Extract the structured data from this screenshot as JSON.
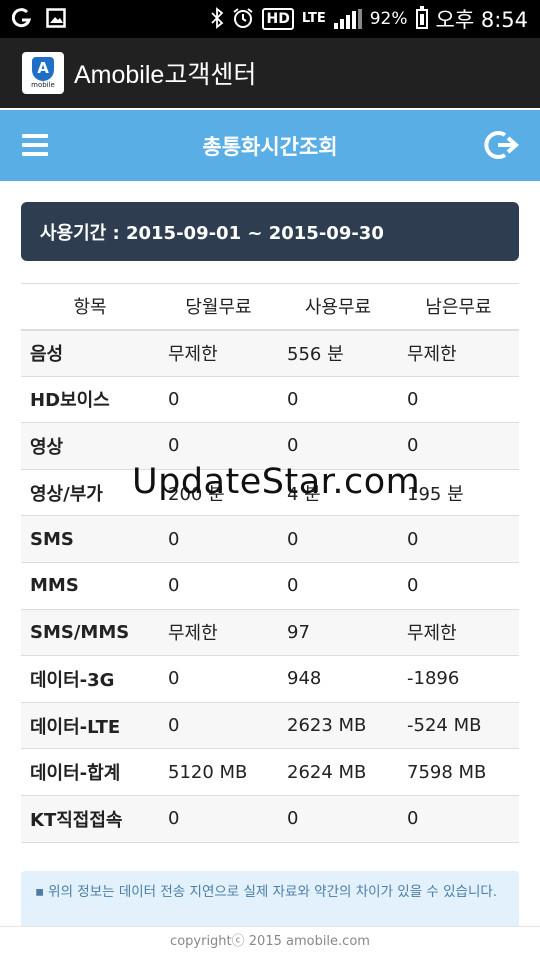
{
  "status_bar": {
    "battery_percent": "92%",
    "time": "오후 8:54",
    "hd_label": "HD",
    "lte_label": "LTE",
    "icons": [
      "g-icon",
      "image-icon",
      "bluetooth-icon",
      "alarm-icon",
      "hd-voice-icon",
      "lte-icon",
      "signal-icon",
      "battery-icon"
    ]
  },
  "app_bar": {
    "logo_letter": "A",
    "logo_text": "mobile",
    "title": "Amobile고객센터"
  },
  "header": {
    "title": "총통화시간조회",
    "accent_color": "#5aaee6"
  },
  "period": {
    "label": "사용기간 : 2015-09-01 ~ 2015-09-30",
    "bg_color": "#2e3e50"
  },
  "usage_table": {
    "headers": [
      "항목",
      "당월무료",
      "사용무료",
      "남은무료"
    ],
    "rows": [
      [
        "음성",
        "무제한",
        "556 분",
        "무제한"
      ],
      [
        "HD보이스",
        "0",
        "0",
        "0"
      ],
      [
        "영상",
        "0",
        "0",
        "0"
      ],
      [
        "영상/부가",
        "200 분",
        "4 분",
        "195 분"
      ],
      [
        "SMS",
        "0",
        "0",
        "0"
      ],
      [
        "MMS",
        "0",
        "0",
        "0"
      ],
      [
        "SMS/MMS",
        "무제한",
        "97",
        "무제한"
      ],
      [
        "데이터-3G",
        "0",
        "948",
        "-1896"
      ],
      [
        "데이터-LTE",
        "0",
        "2623 MB",
        "-524 MB"
      ],
      [
        "데이터-합계",
        "5120 MB",
        "2624 MB",
        "7598 MB"
      ],
      [
        "KT직접접속",
        "0",
        "0",
        "0"
      ]
    ]
  },
  "watermark": "UpdateStar.com",
  "notice": {
    "bullet": "▪",
    "text": "위의 정보는 데이터 전송 지연으로 실제 자료와 약간의 차이가 있을 수 있습니다."
  },
  "footer": {
    "copyright": "copyrightⓒ 2015 amobile.com"
  }
}
